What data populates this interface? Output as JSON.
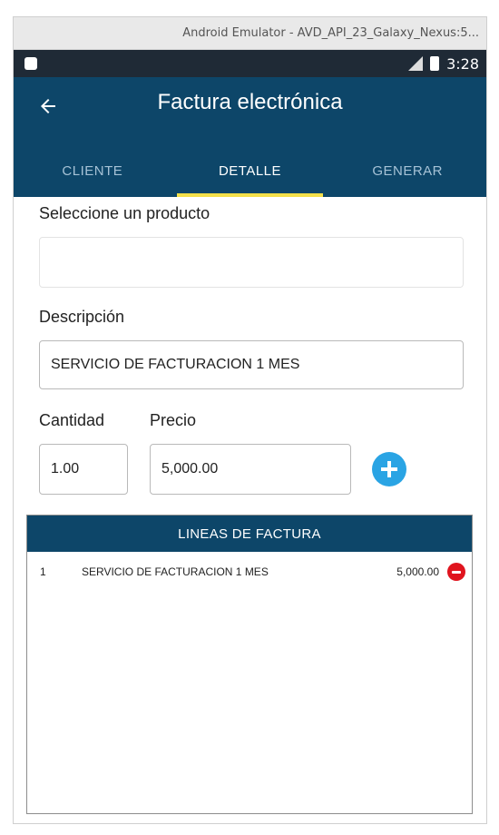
{
  "emulator": {
    "window_title": "Android Emulator - AVD_API_23_Galaxy_Nexus:5..."
  },
  "status_bar": {
    "time": "3:28",
    "icons": [
      "android-notification-icon",
      "signal-icon",
      "battery-icon"
    ]
  },
  "app_bar": {
    "title": "Factura electrónica",
    "back_icon": "arrow-back-icon",
    "tabs": [
      {
        "label": "CLIENTE",
        "active": false
      },
      {
        "label": "DETALLE",
        "active": true
      },
      {
        "label": "GENERAR",
        "active": false
      }
    ]
  },
  "form": {
    "product": {
      "label": "Seleccione un producto",
      "value": ""
    },
    "description": {
      "label": "Descripción",
      "value": "SERVICIO DE FACTURACION 1 MES"
    },
    "quantity": {
      "label": "Cantidad",
      "value": "1.00"
    },
    "price": {
      "label": "Precio",
      "value": "5,000.00"
    },
    "add_icon": "plus-circle-icon"
  },
  "invoice_lines": {
    "header": "LINEAS DE FACTURA",
    "rows": [
      {
        "num": "1",
        "description": "SERVICIO DE FACTURACION 1 MES",
        "amount": "5,000.00",
        "remove_icon": "minus-circle-icon"
      }
    ]
  },
  "colors": {
    "primary": "#0d4669",
    "tab_indicator": "#f3e04a",
    "add_button": "#2aa4e4",
    "remove_button": "#e0141e"
  }
}
